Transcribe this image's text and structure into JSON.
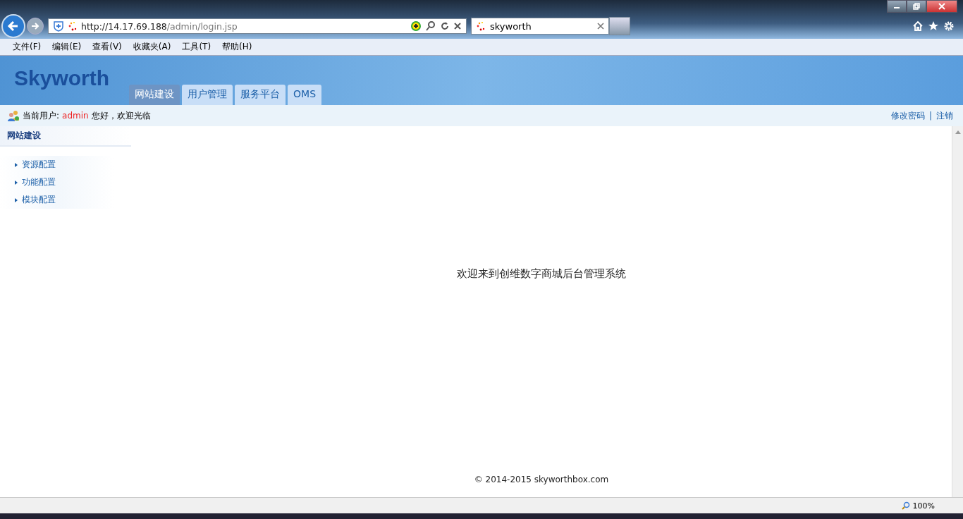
{
  "browser": {
    "url_host": "http://14.17.69.188",
    "url_path": "/admin/login.jsp",
    "tabs": [
      {
        "title": "skyworth",
        "selected": true
      }
    ]
  },
  "menu_bar": [
    "文件(F)",
    "编辑(E)",
    "查看(V)",
    "收藏夹(A)",
    "工具(T)",
    "帮助(H)"
  ],
  "header": {
    "logo": "Skyworth",
    "nav_tabs": [
      {
        "label": "网站建设",
        "selected": true
      },
      {
        "label": "用户管理",
        "selected": false
      },
      {
        "label": "服务平台",
        "selected": false
      },
      {
        "label": "OMS",
        "selected": false
      }
    ]
  },
  "user_bar": {
    "label": "当前用户:",
    "user": "admin",
    "greeting": "您好，欢迎光临",
    "links": [
      "修改密码",
      "注销"
    ],
    "separator": "|"
  },
  "sidebar": {
    "title": "网站建设",
    "items": [
      "资源配置",
      "功能配置",
      "模块配置"
    ]
  },
  "main": {
    "welcome": "欢迎来到创维数字商城后台管理系统",
    "footer": "© 2014-2015 skyworthbox.com"
  },
  "status_bar": {
    "zoom": "100%"
  }
}
